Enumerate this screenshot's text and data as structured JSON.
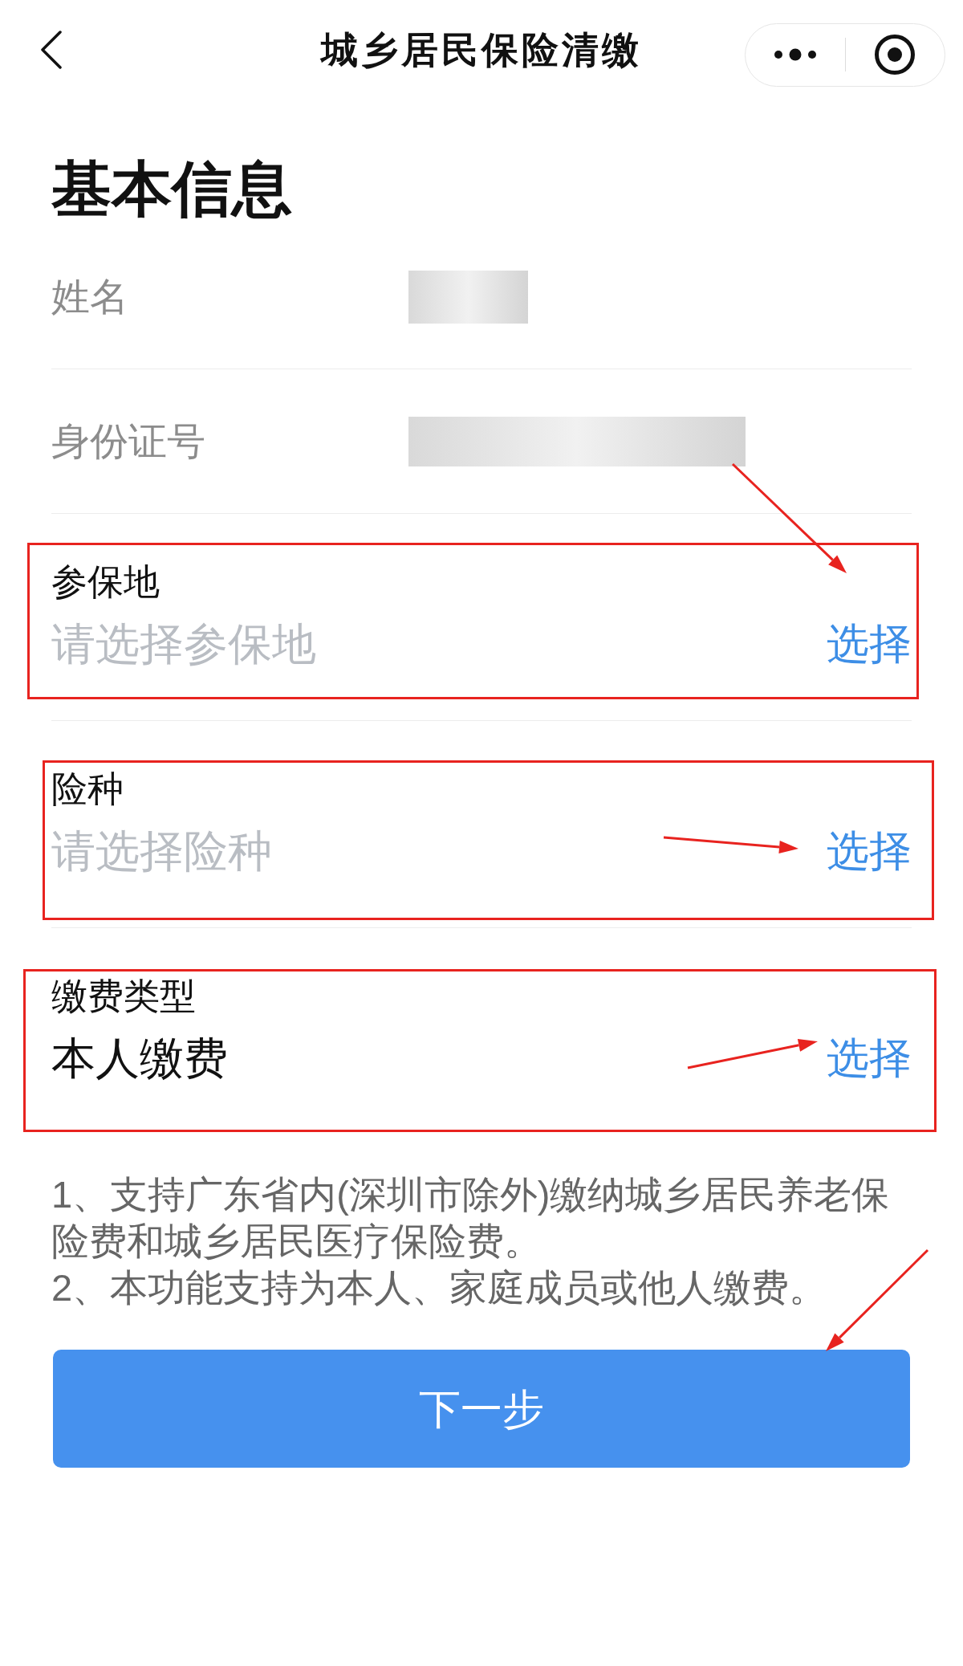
{
  "nav_bar": {
    "title": "城乡居民保险清缴"
  },
  "section_title": "基本信息",
  "fields": [
    {
      "kind": "info",
      "label": "姓名"
    },
    {
      "kind": "info",
      "label": "身份证号"
    },
    {
      "kind": "select",
      "label": "参保地",
      "placeholder": "请选择参保地",
      "action": "选择"
    },
    {
      "kind": "select",
      "label": "险种",
      "placeholder": "请选择险种",
      "action": "选择"
    },
    {
      "kind": "select",
      "label": "缴费类型",
      "value": "本人缴费",
      "action": "选择"
    }
  ],
  "notes": [
    "1、支持广东省内(深圳市除外)缴纳城乡居民养老保险费和城乡居民医疗保险费。",
    "2、本功能支持为本人、家庭成员或他人缴费。"
  ],
  "next_button": "下一步"
}
